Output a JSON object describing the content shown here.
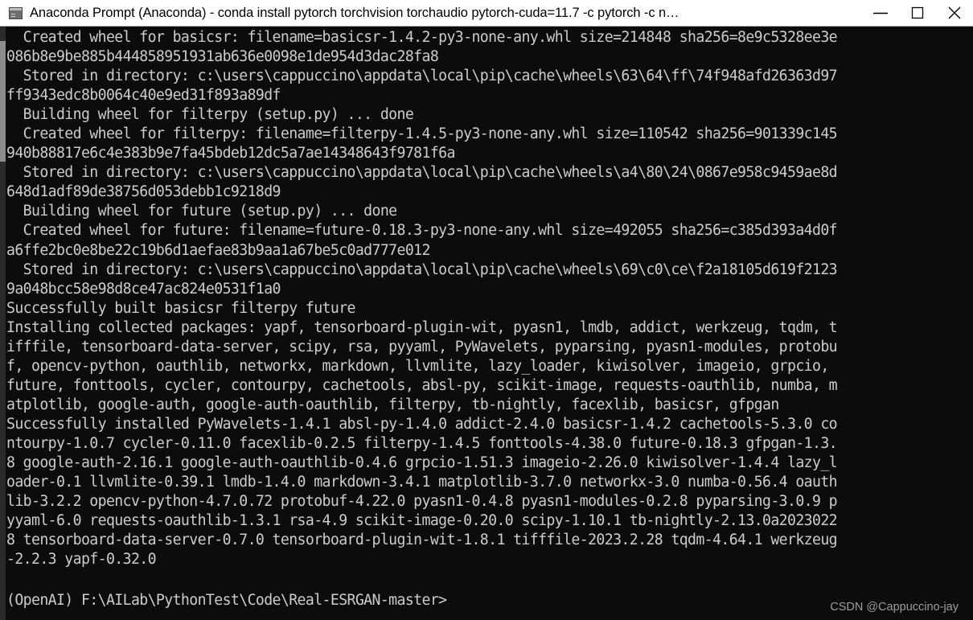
{
  "window": {
    "title": "Anaconda Prompt (Anaconda) - conda  install pytorch torchvision torchaudio pytorch-cuda=11.7 -c pytorch -c n…",
    "icon": "console-icon",
    "controls": {
      "minimize_label": "Minimize",
      "maximize_label": "Maximize",
      "close_label": "Close"
    },
    "colors": {
      "titlebar_background": "#ffffff",
      "titlebar_text": "#000000",
      "terminal_background": "#0c0c0c",
      "terminal_text": "#cccccc",
      "scrollbar_thumb": "#8d8d8d",
      "watermark_text": "#9b9b9b"
    }
  },
  "terminal": {
    "lines": [
      "  Created wheel for basicsr: filename=basicsr-1.4.2-py3-none-any.whl size=214848 sha256=8e9c5328ee3e",
      "086b8e9be885b444858951931ab636e0098e1de954d3dac28fa8",
      "  Stored in directory: c:\\users\\cappuccino\\appdata\\local\\pip\\cache\\wheels\\63\\64\\ff\\74f948afd26363d97",
      "ff9343edc8b0064c40e9ed31f893a89df",
      "  Building wheel for filterpy (setup.py) ... done",
      "  Created wheel for filterpy: filename=filterpy-1.4.5-py3-none-any.whl size=110542 sha256=901339c145",
      "940b88817e6c4e383b9e7fa45bdeb12dc5a7ae14348643f9781f6a",
      "  Stored in directory: c:\\users\\cappuccino\\appdata\\local\\pip\\cache\\wheels\\a4\\80\\24\\0867e958c9459ae8d",
      "648d1adf89de38756d053debb1c9218d9",
      "  Building wheel for future (setup.py) ... done",
      "  Created wheel for future: filename=future-0.18.3-py3-none-any.whl size=492055 sha256=c385d393a4d0f",
      "a6ffe2bc0e8be22c19b6d1aefae83b9aa1a67be5c0ad777e012",
      "  Stored in directory: c:\\users\\cappuccino\\appdata\\local\\pip\\cache\\wheels\\69\\c0\\ce\\f2a18105d619f2123",
      "9a048bcc58e98d8ce47ac824e0531f1a0",
      "Successfully built basicsr filterpy future",
      "Installing collected packages: yapf, tensorboard-plugin-wit, pyasn1, lmdb, addict, werkzeug, tqdm, t",
      "ifffile, tensorboard-data-server, scipy, rsa, pyyaml, PyWavelets, pyparsing, pyasn1-modules, protobu",
      "f, opencv-python, oauthlib, networkx, markdown, llvmlite, lazy_loader, kiwisolver, imageio, grpcio,",
      "future, fonttools, cycler, contourpy, cachetools, absl-py, scikit-image, requests-oauthlib, numba, m",
      "atplotlib, google-auth, google-auth-oauthlib, filterpy, tb-nightly, facexlib, basicsr, gfpgan",
      "Successfully installed PyWavelets-1.4.1 absl-py-1.4.0 addict-2.4.0 basicsr-1.4.2 cachetools-5.3.0 co",
      "ntourpy-1.0.7 cycler-0.11.0 facexlib-0.2.5 filterpy-1.4.5 fonttools-4.38.0 future-0.18.3 gfpgan-1.3.",
      "8 google-auth-2.16.1 google-auth-oauthlib-0.4.6 grpcio-1.51.3 imageio-2.26.0 kiwisolver-1.4.4 lazy_l",
      "oader-0.1 llvmlite-0.39.1 lmdb-1.4.0 markdown-3.4.1 matplotlib-3.7.0 networkx-3.0 numba-0.56.4 oauth",
      "lib-3.2.2 opencv-python-4.7.0.72 protobuf-4.22.0 pyasn1-0.4.8 pyasn1-modules-0.2.8 pyparsing-3.0.9 p",
      "yyaml-6.0 requests-oauthlib-1.3.1 rsa-4.9 scikit-image-0.20.0 scipy-1.10.1 tb-nightly-2.13.0a2023022",
      "8 tensorboard-data-server-0.7.0 tensorboard-plugin-wit-1.8.1 tifffile-2023.2.28 tqdm-4.64.1 werkzeug",
      "-2.2.3 yapf-0.32.0"
    ],
    "prompt": "(OpenAI) F:\\AILab\\PythonTest\\Code\\Real-ESRGAN-master>"
  },
  "watermark": {
    "text": "CSDN @Cappuccino-jay"
  }
}
